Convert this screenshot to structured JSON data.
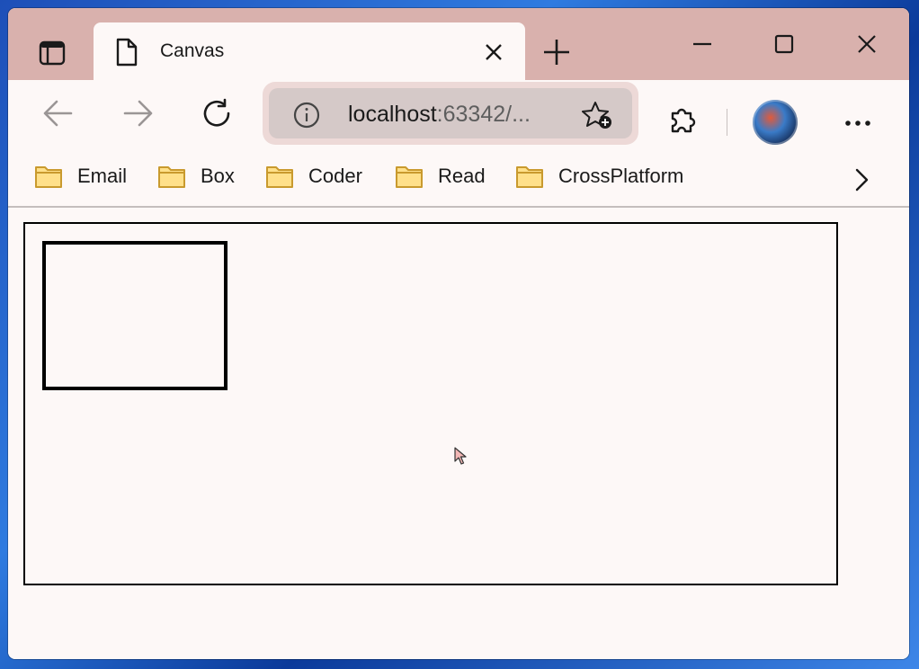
{
  "tab": {
    "title": "Canvas"
  },
  "address_bar": {
    "host": "localhost",
    "path": ":63342/..."
  },
  "bookmarks": [
    {
      "label": "Email"
    },
    {
      "label": "Box"
    },
    {
      "label": "Coder"
    },
    {
      "label": "Read"
    },
    {
      "label": "CrossPlatform"
    }
  ],
  "icons": {
    "tab_actions": "tab-actions-icon",
    "favicon": "page-icon",
    "close_tab": "close-icon",
    "new_tab": "plus-icon",
    "minimize": "minimize-icon",
    "maximize": "maximize-icon",
    "close_window": "close-icon",
    "back": "arrow-left-icon",
    "forward": "arrow-right-icon",
    "refresh": "refresh-icon",
    "site_info": "info-icon",
    "favorite": "star-add-icon",
    "extensions": "puzzle-icon",
    "more": "more-icon",
    "folder": "folder-icon",
    "bookmarks_more": "chevron-right-icon"
  },
  "colors": {
    "titlebar": "#d9b1ad",
    "page_background": "#fdf8f7",
    "folder_fill": "#ffe08a",
    "folder_stroke": "#c99a2e"
  }
}
